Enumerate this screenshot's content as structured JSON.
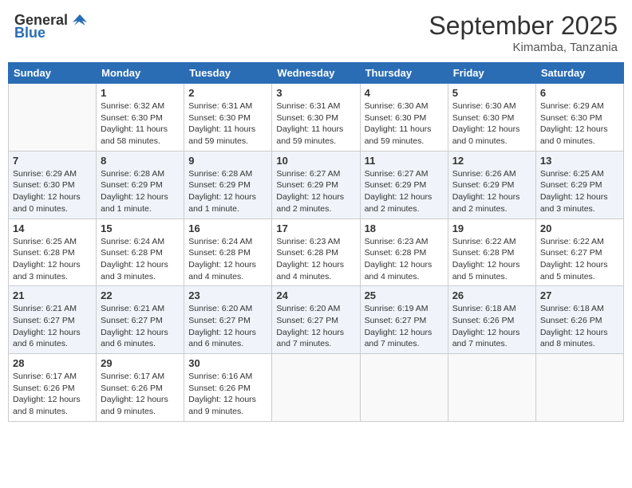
{
  "header": {
    "logo_general": "General",
    "logo_blue": "Blue",
    "month_title": "September 2025",
    "location": "Kimamba, Tanzania"
  },
  "weekdays": [
    "Sunday",
    "Monday",
    "Tuesday",
    "Wednesday",
    "Thursday",
    "Friday",
    "Saturday"
  ],
  "weeks": [
    [
      {
        "day": "",
        "info": ""
      },
      {
        "day": "1",
        "info": "Sunrise: 6:32 AM\nSunset: 6:30 PM\nDaylight: 11 hours\nand 58 minutes."
      },
      {
        "day": "2",
        "info": "Sunrise: 6:31 AM\nSunset: 6:30 PM\nDaylight: 11 hours\nand 59 minutes."
      },
      {
        "day": "3",
        "info": "Sunrise: 6:31 AM\nSunset: 6:30 PM\nDaylight: 11 hours\nand 59 minutes."
      },
      {
        "day": "4",
        "info": "Sunrise: 6:30 AM\nSunset: 6:30 PM\nDaylight: 11 hours\nand 59 minutes."
      },
      {
        "day": "5",
        "info": "Sunrise: 6:30 AM\nSunset: 6:30 PM\nDaylight: 12 hours\nand 0 minutes."
      },
      {
        "day": "6",
        "info": "Sunrise: 6:29 AM\nSunset: 6:30 PM\nDaylight: 12 hours\nand 0 minutes."
      }
    ],
    [
      {
        "day": "7",
        "info": "Sunrise: 6:29 AM\nSunset: 6:30 PM\nDaylight: 12 hours\nand 0 minutes."
      },
      {
        "day": "8",
        "info": "Sunrise: 6:28 AM\nSunset: 6:29 PM\nDaylight: 12 hours\nand 1 minute."
      },
      {
        "day": "9",
        "info": "Sunrise: 6:28 AM\nSunset: 6:29 PM\nDaylight: 12 hours\nand 1 minute."
      },
      {
        "day": "10",
        "info": "Sunrise: 6:27 AM\nSunset: 6:29 PM\nDaylight: 12 hours\nand 2 minutes."
      },
      {
        "day": "11",
        "info": "Sunrise: 6:27 AM\nSunset: 6:29 PM\nDaylight: 12 hours\nand 2 minutes."
      },
      {
        "day": "12",
        "info": "Sunrise: 6:26 AM\nSunset: 6:29 PM\nDaylight: 12 hours\nand 2 minutes."
      },
      {
        "day": "13",
        "info": "Sunrise: 6:25 AM\nSunset: 6:29 PM\nDaylight: 12 hours\nand 3 minutes."
      }
    ],
    [
      {
        "day": "14",
        "info": "Sunrise: 6:25 AM\nSunset: 6:28 PM\nDaylight: 12 hours\nand 3 minutes."
      },
      {
        "day": "15",
        "info": "Sunrise: 6:24 AM\nSunset: 6:28 PM\nDaylight: 12 hours\nand 3 minutes."
      },
      {
        "day": "16",
        "info": "Sunrise: 6:24 AM\nSunset: 6:28 PM\nDaylight: 12 hours\nand 4 minutes."
      },
      {
        "day": "17",
        "info": "Sunrise: 6:23 AM\nSunset: 6:28 PM\nDaylight: 12 hours\nand 4 minutes."
      },
      {
        "day": "18",
        "info": "Sunrise: 6:23 AM\nSunset: 6:28 PM\nDaylight: 12 hours\nand 4 minutes."
      },
      {
        "day": "19",
        "info": "Sunrise: 6:22 AM\nSunset: 6:28 PM\nDaylight: 12 hours\nand 5 minutes."
      },
      {
        "day": "20",
        "info": "Sunrise: 6:22 AM\nSunset: 6:27 PM\nDaylight: 12 hours\nand 5 minutes."
      }
    ],
    [
      {
        "day": "21",
        "info": "Sunrise: 6:21 AM\nSunset: 6:27 PM\nDaylight: 12 hours\nand 6 minutes."
      },
      {
        "day": "22",
        "info": "Sunrise: 6:21 AM\nSunset: 6:27 PM\nDaylight: 12 hours\nand 6 minutes."
      },
      {
        "day": "23",
        "info": "Sunrise: 6:20 AM\nSunset: 6:27 PM\nDaylight: 12 hours\nand 6 minutes."
      },
      {
        "day": "24",
        "info": "Sunrise: 6:20 AM\nSunset: 6:27 PM\nDaylight: 12 hours\nand 7 minutes."
      },
      {
        "day": "25",
        "info": "Sunrise: 6:19 AM\nSunset: 6:27 PM\nDaylight: 12 hours\nand 7 minutes."
      },
      {
        "day": "26",
        "info": "Sunrise: 6:18 AM\nSunset: 6:26 PM\nDaylight: 12 hours\nand 7 minutes."
      },
      {
        "day": "27",
        "info": "Sunrise: 6:18 AM\nSunset: 6:26 PM\nDaylight: 12 hours\nand 8 minutes."
      }
    ],
    [
      {
        "day": "28",
        "info": "Sunrise: 6:17 AM\nSunset: 6:26 PM\nDaylight: 12 hours\nand 8 minutes."
      },
      {
        "day": "29",
        "info": "Sunrise: 6:17 AM\nSunset: 6:26 PM\nDaylight: 12 hours\nand 9 minutes."
      },
      {
        "day": "30",
        "info": "Sunrise: 6:16 AM\nSunset: 6:26 PM\nDaylight: 12 hours\nand 9 minutes."
      },
      {
        "day": "",
        "info": ""
      },
      {
        "day": "",
        "info": ""
      },
      {
        "day": "",
        "info": ""
      },
      {
        "day": "",
        "info": ""
      }
    ]
  ]
}
